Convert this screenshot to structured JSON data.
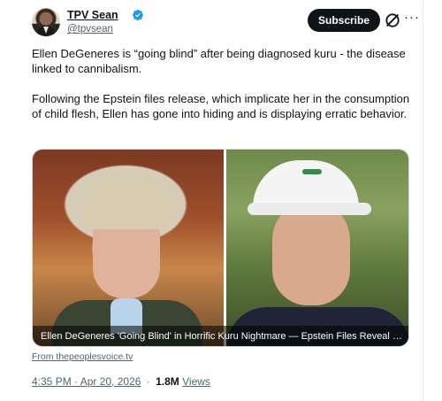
{
  "author": {
    "display_name": "TPV Sean",
    "handle": "@tpvsean",
    "verified_icon": "verified-badge-icon",
    "avatar_icon": "avatar"
  },
  "actions": {
    "subscribe_label": "Subscribe",
    "grok_icon": "grok-icon",
    "more_icon": "more-icon",
    "more_glyph": "···"
  },
  "tweet": {
    "paragraph_1": "Ellen DeGeneres is “going blind” after being diagnosed kuru - the disease linked to cannibalism.",
    "paragraph_2": "Following the Epstein files release, which implicate her in the consumption of child flesh, Ellen has gone into hiding and is displaying erratic behavior."
  },
  "media": {
    "caption": "Ellen DeGeneres 'Going Blind' in Horrific Kuru Nightmare — Epstein Files Reveal She At…",
    "source": "From thepeoplesvoice.tv"
  },
  "meta": {
    "time": "4:35 PM · Apr 20, 2026",
    "separator": "·",
    "views_count": "1.8M",
    "views_label": "Views"
  },
  "colors": {
    "text_primary": "#0f1419",
    "text_secondary": "#536471",
    "verified_blue": "#1d9bf0",
    "button_dark": "#0f1419"
  }
}
